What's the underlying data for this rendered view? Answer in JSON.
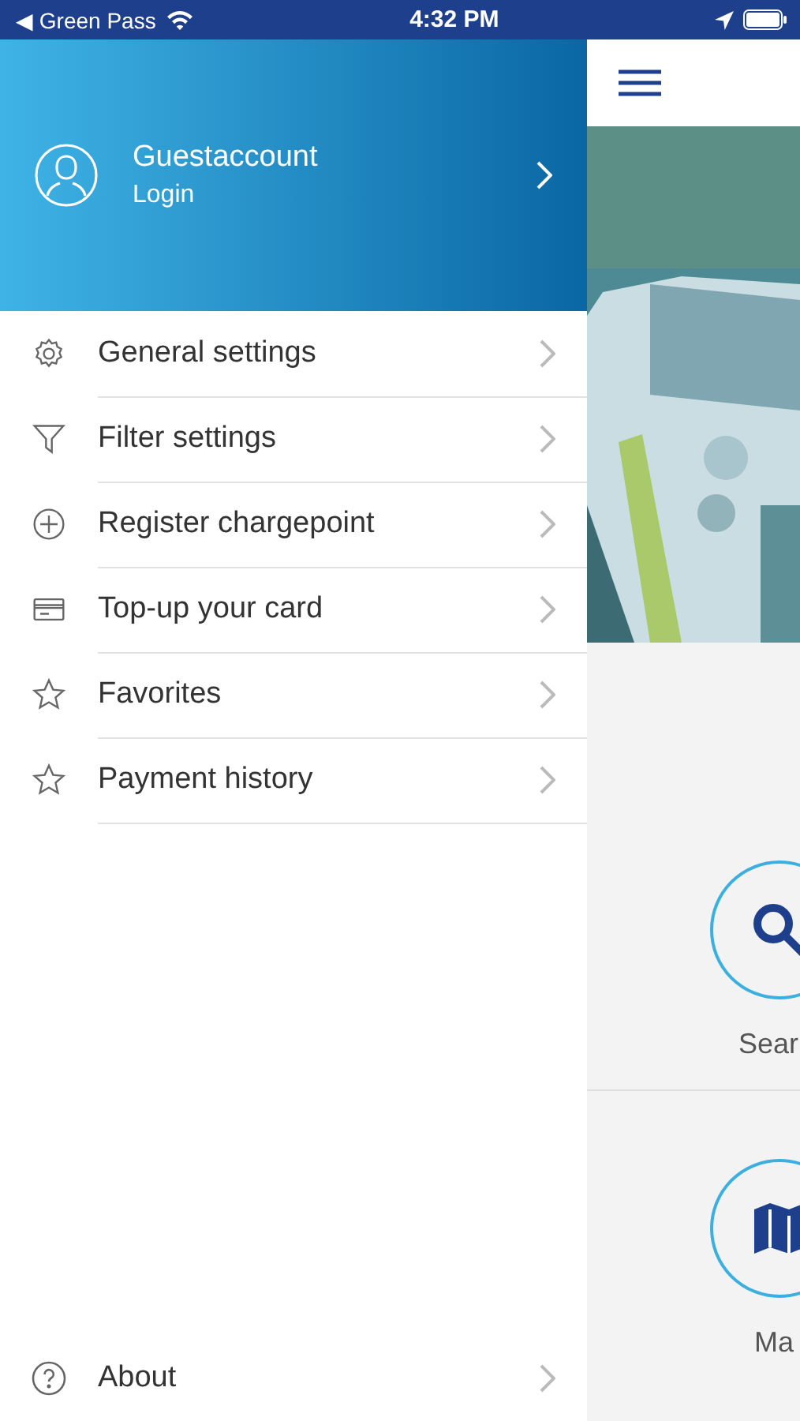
{
  "status_bar": {
    "back_label": "◀ Green Pass",
    "time": "4:32 PM"
  },
  "drawer": {
    "account": {
      "name": "Guestaccount",
      "action": "Login"
    },
    "items": [
      {
        "label": "General settings"
      },
      {
        "label": "Filter settings"
      },
      {
        "label": "Register chargepoint"
      },
      {
        "label": "Top-up your card"
      },
      {
        "label": "Favorites"
      },
      {
        "label": "Payment history"
      }
    ],
    "footer_item": {
      "label": "About"
    }
  },
  "main": {
    "tiles": [
      {
        "label": "Sear"
      },
      {
        "label": "Ma"
      }
    ]
  }
}
